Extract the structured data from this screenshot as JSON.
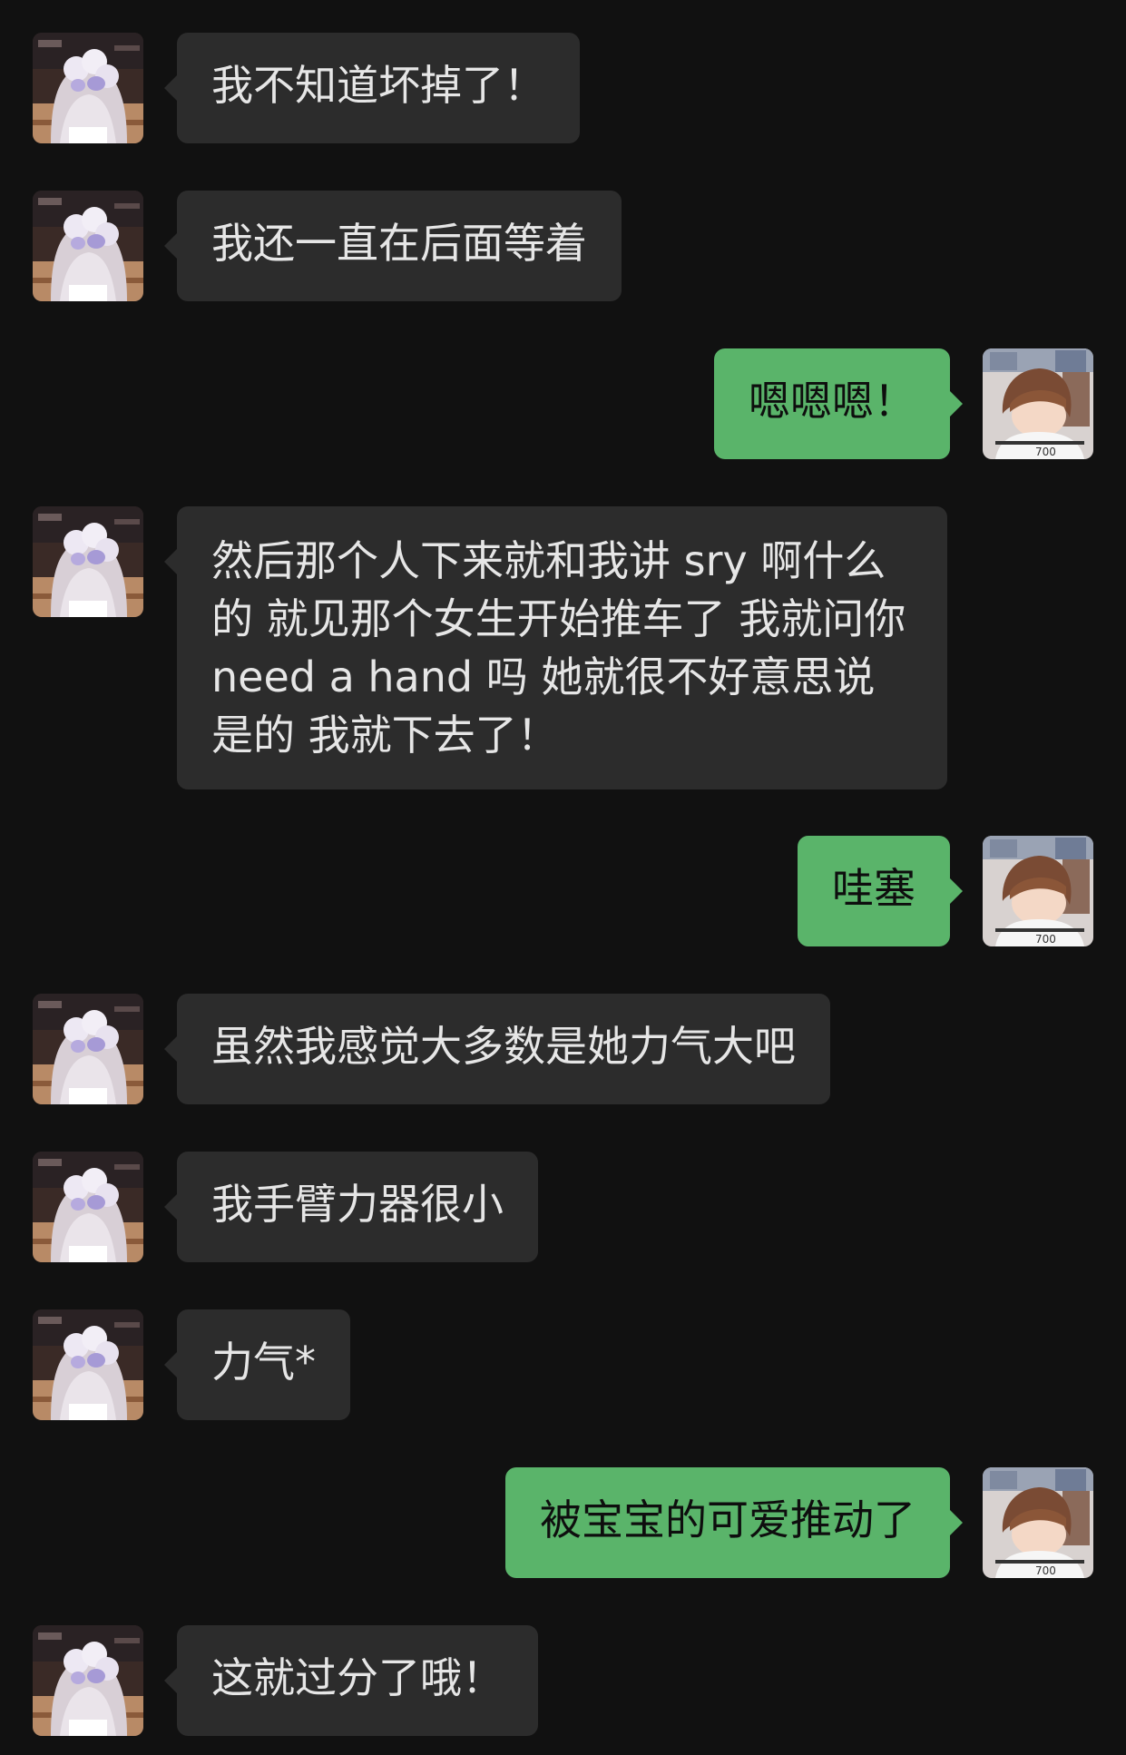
{
  "colors": {
    "background": "#111111",
    "incoming_bubble": "#2c2c2c",
    "outgoing_bubble": "#5ab46a",
    "incoming_text": "#e6e6e6",
    "outgoing_text": "#0e0e0e"
  },
  "contact": {
    "avatar_icon": "anime-girl-avatar-icon"
  },
  "self": {
    "avatar_icon": "anime-boy-avatar-icon"
  },
  "messages": [
    {
      "direction": "in",
      "text": "我不知道坏掉了！"
    },
    {
      "direction": "in",
      "text": "我还一直在后面等着"
    },
    {
      "direction": "out",
      "text": "嗯嗯嗯！"
    },
    {
      "direction": "in",
      "text": "然后那个人下来就和我讲 sry 啊什么的 就见那个女生开始推车了 我就问你 need a hand 吗 她就很不好意思说是的 我就下去了！"
    },
    {
      "direction": "out",
      "text": "哇塞"
    },
    {
      "direction": "in",
      "text": "虽然我感觉大多数是她力气大吧"
    },
    {
      "direction": "in",
      "text": "我手臂力器很小"
    },
    {
      "direction": "in",
      "text": "力气*"
    },
    {
      "direction": "out",
      "text": "被宝宝的可爱推动了"
    },
    {
      "direction": "in",
      "text": "这就过分了哦！"
    }
  ]
}
